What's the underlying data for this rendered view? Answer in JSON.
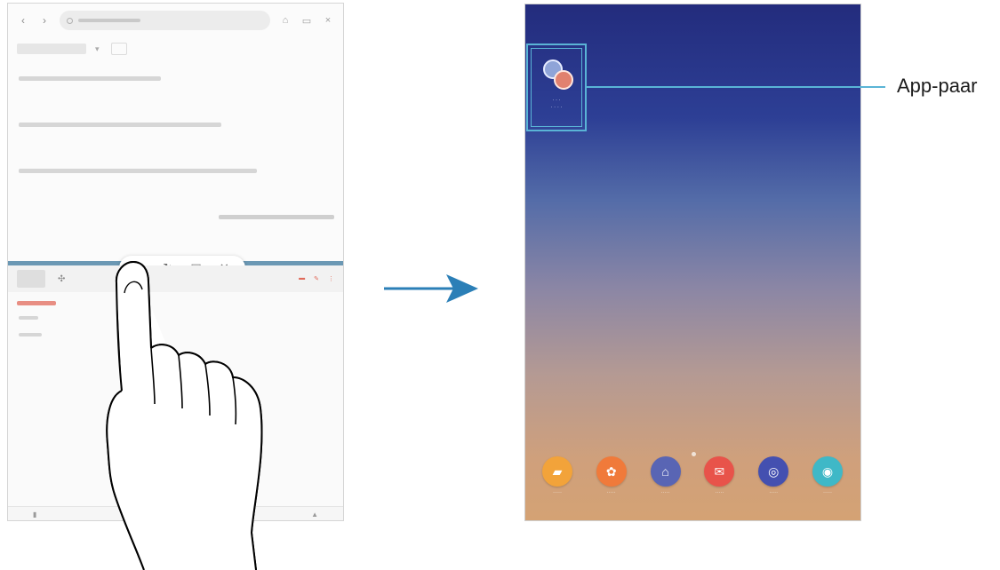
{
  "left_screen": {
    "browser": {
      "back_icon": "chevron-left-icon",
      "forward_icon": "chevron-right-icon",
      "home_icon": "home-icon",
      "bookmark_icon": "star-icon",
      "tabs_icon": "tabs-icon",
      "menu_icon": "more-icon"
    },
    "split_controls": [
      "app-pair-icon",
      "swap-icon",
      "window-icon",
      "close-icon"
    ]
  },
  "right_screen": {
    "app_pair": {
      "icon": "app-pair-icon"
    },
    "dock": [
      {
        "icon": "folder-icon",
        "color": "#f2a33a"
      },
      {
        "icon": "gallery-icon",
        "color": "#f07a3a"
      },
      {
        "icon": "store-icon",
        "color": "#5965b4"
      },
      {
        "icon": "mail-icon",
        "color": "#e8534a"
      },
      {
        "icon": "internet-icon",
        "color": "#4450b0"
      },
      {
        "icon": "camera-icon",
        "color": "#3fb8c7"
      }
    ]
  },
  "callout": {
    "label": "App-paar"
  },
  "colors": {
    "highlight": "#5ab4d6",
    "arrow": "#2b7fb7",
    "split_bar": "#6b98b4"
  }
}
